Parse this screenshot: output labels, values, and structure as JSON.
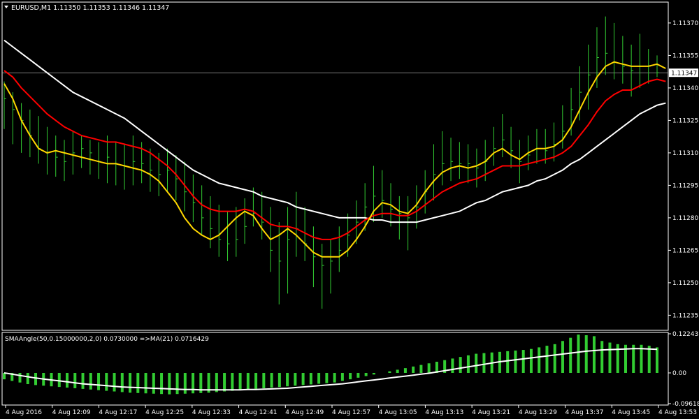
{
  "window": {
    "symbol_header": "EURUSD,M1  1.11350 1.11353 1.11346 1.11347",
    "current_price_label": "1.11347"
  },
  "colors": {
    "background": "#000000",
    "axis": "#ffffff",
    "bars": "#32cd32",
    "ma_fast": "#ffd700",
    "ma_mid": "#ff0000",
    "ma_slow": "#ffffff",
    "price_line": "#c0c0c0"
  },
  "icons": {
    "header_arrow": "triangle-down-icon"
  },
  "chart_data": [
    {
      "type": "line",
      "title": "EURUSD,M1",
      "ylim": [
        1.11229,
        1.11379
      ],
      "y_ticks": [
        "1.11370",
        "1.11355",
        "1.11340",
        "1.11325",
        "1.11310",
        "1.11295",
        "1.11280",
        "1.11265",
        "1.11250",
        "1.11235"
      ],
      "y_tick_values": [
        1.1137,
        1.11355,
        1.1134,
        1.11325,
        1.1131,
        1.11295,
        1.1128,
        1.11265,
        1.1125,
        1.11235
      ],
      "current_price": 1.11347,
      "bars": [
        {
          "h": 1.11343,
          "l": 1.11321,
          "c": 1.11335
        },
        {
          "h": 1.11338,
          "l": 1.11314,
          "c": 1.1133
        },
        {
          "h": 1.11333,
          "l": 1.1131,
          "c": 1.11325
        },
        {
          "h": 1.1133,
          "l": 1.11308,
          "c": 1.11318
        },
        {
          "h": 1.11327,
          "l": 1.11305,
          "c": 1.11312
        },
        {
          "h": 1.11322,
          "l": 1.113,
          "c": 1.1131
        },
        {
          "h": 1.11318,
          "l": 1.11299,
          "c": 1.11308
        },
        {
          "h": 1.11316,
          "l": 1.11297,
          "c": 1.11306
        },
        {
          "h": 1.1132,
          "l": 1.113,
          "c": 1.1131
        },
        {
          "h": 1.11318,
          "l": 1.11303,
          "c": 1.11312
        },
        {
          "h": 1.11316,
          "l": 1.113,
          "c": 1.1131
        },
        {
          "h": 1.11315,
          "l": 1.11298,
          "c": 1.11306
        },
        {
          "h": 1.11318,
          "l": 1.11296,
          "c": 1.11308
        },
        {
          "h": 1.11315,
          "l": 1.11295,
          "c": 1.11305
        },
        {
          "h": 1.11314,
          "l": 1.11293,
          "c": 1.11304
        },
        {
          "h": 1.11318,
          "l": 1.11295,
          "c": 1.11306
        },
        {
          "h": 1.11315,
          "l": 1.11296,
          "c": 1.11305
        },
        {
          "h": 1.11312,
          "l": 1.11292,
          "c": 1.11302
        },
        {
          "h": 1.1131,
          "l": 1.1129,
          "c": 1.113
        },
        {
          "h": 1.11312,
          "l": 1.11292,
          "c": 1.11302
        },
        {
          "h": 1.11309,
          "l": 1.11288,
          "c": 1.11298
        },
        {
          "h": 1.11306,
          "l": 1.11283,
          "c": 1.11292
        },
        {
          "h": 1.113,
          "l": 1.11278,
          "c": 1.11287
        },
        {
          "h": 1.11295,
          "l": 1.11272,
          "c": 1.1128
        },
        {
          "h": 1.1129,
          "l": 1.11266,
          "c": 1.11275
        },
        {
          "h": 1.11286,
          "l": 1.11262,
          "c": 1.1127
        },
        {
          "h": 1.11283,
          "l": 1.1126,
          "c": 1.11268
        },
        {
          "h": 1.11285,
          "l": 1.11262,
          "c": 1.1127
        },
        {
          "h": 1.11289,
          "l": 1.11268,
          "c": 1.11276
        },
        {
          "h": 1.11294,
          "l": 1.11276,
          "c": 1.11282
        },
        {
          "h": 1.11292,
          "l": 1.1127,
          "c": 1.11278
        },
        {
          "h": 1.11285,
          "l": 1.11255,
          "c": 1.11265
        },
        {
          "h": 1.11278,
          "l": 1.1124,
          "c": 1.1126
        },
        {
          "h": 1.11285,
          "l": 1.11245,
          "c": 1.1127
        },
        {
          "h": 1.11292,
          "l": 1.11262,
          "c": 1.11275
        },
        {
          "h": 1.11285,
          "l": 1.1126,
          "c": 1.11268
        },
        {
          "h": 1.11276,
          "l": 1.11248,
          "c": 1.11262
        },
        {
          "h": 1.11268,
          "l": 1.11238,
          "c": 1.11258
        },
        {
          "h": 1.1127,
          "l": 1.11245,
          "c": 1.1126
        },
        {
          "h": 1.11276,
          "l": 1.11255,
          "c": 1.11265
        },
        {
          "h": 1.11282,
          "l": 1.11262,
          "c": 1.11272
        },
        {
          "h": 1.11288,
          "l": 1.11268,
          "c": 1.11278
        },
        {
          "h": 1.11296,
          "l": 1.11274,
          "c": 1.11285
        },
        {
          "h": 1.11304,
          "l": 1.11278,
          "c": 1.1129
        },
        {
          "h": 1.11302,
          "l": 1.1128,
          "c": 1.11288
        },
        {
          "h": 1.11296,
          "l": 1.11276,
          "c": 1.11284
        },
        {
          "h": 1.1129,
          "l": 1.1127,
          "c": 1.11282
        },
        {
          "h": 1.1129,
          "l": 1.11265,
          "c": 1.1128
        },
        {
          "h": 1.11295,
          "l": 1.11275,
          "c": 1.11285
        },
        {
          "h": 1.11302,
          "l": 1.11282,
          "c": 1.11292
        },
        {
          "h": 1.11314,
          "l": 1.11288,
          "c": 1.113
        },
        {
          "h": 1.1132,
          "l": 1.11295,
          "c": 1.11305
        },
        {
          "h": 1.11317,
          "l": 1.11297,
          "c": 1.11306
        },
        {
          "h": 1.11315,
          "l": 1.11298,
          "c": 1.11305
        },
        {
          "h": 1.11314,
          "l": 1.11296,
          "c": 1.11305
        },
        {
          "h": 1.11312,
          "l": 1.11294,
          "c": 1.11303
        },
        {
          "h": 1.11316,
          "l": 1.11297,
          "c": 1.11306
        },
        {
          "h": 1.11322,
          "l": 1.11304,
          "c": 1.11312
        },
        {
          "h": 1.11328,
          "l": 1.11308,
          "c": 1.11316
        },
        {
          "h": 1.11322,
          "l": 1.11303,
          "c": 1.11311
        },
        {
          "h": 1.11316,
          "l": 1.11296,
          "c": 1.11306
        },
        {
          "h": 1.11318,
          "l": 1.11302,
          "c": 1.11309
        },
        {
          "h": 1.11321,
          "l": 1.11305,
          "c": 1.11312
        },
        {
          "h": 1.11321,
          "l": 1.11305,
          "c": 1.11311
        },
        {
          "h": 1.11324,
          "l": 1.11306,
          "c": 1.11314
        },
        {
          "h": 1.11332,
          "l": 1.11312,
          "c": 1.1132
        },
        {
          "h": 1.1134,
          "l": 1.11318,
          "c": 1.1133
        },
        {
          "h": 1.1135,
          "l": 1.11325,
          "c": 1.11338
        },
        {
          "h": 1.1136,
          "l": 1.1133,
          "c": 1.11346
        },
        {
          "h": 1.11368,
          "l": 1.1134,
          "c": 1.11354
        },
        {
          "h": 1.11373,
          "l": 1.11346,
          "c": 1.11356
        },
        {
          "h": 1.1137,
          "l": 1.11344,
          "c": 1.11352
        },
        {
          "h": 1.11364,
          "l": 1.11342,
          "c": 1.1135
        },
        {
          "h": 1.1136,
          "l": 1.11336,
          "c": 1.11348
        },
        {
          "h": 1.11365,
          "l": 1.1134,
          "c": 1.1135
        },
        {
          "h": 1.11358,
          "l": 1.11342,
          "c": 1.1135
        },
        {
          "h": 1.11355,
          "l": 1.11345,
          "c": 1.11347
        }
      ],
      "series": [
        {
          "role": "ma_fast",
          "values": [
            1.11342,
            1.11335,
            1.11325,
            1.11318,
            1.11312,
            1.1131,
            1.11311,
            1.1131,
            1.11309,
            1.11308,
            1.11307,
            1.11306,
            1.11305,
            1.11305,
            1.11304,
            1.11303,
            1.11302,
            1.113,
            1.11297,
            1.11292,
            1.11287,
            1.1128,
            1.11275,
            1.11272,
            1.1127,
            1.11272,
            1.11276,
            1.1128,
            1.11283,
            1.11281,
            1.11275,
            1.1127,
            1.11272,
            1.11275,
            1.11272,
            1.11268,
            1.11264,
            1.11262,
            1.11262,
            1.11262,
            1.11265,
            1.1127,
            1.11276,
            1.11283,
            1.11287,
            1.11286,
            1.11283,
            1.11282,
            1.11286,
            1.11292,
            1.11297,
            1.11301,
            1.11303,
            1.11304,
            1.11303,
            1.11304,
            1.11306,
            1.1131,
            1.11312,
            1.11309,
            1.11307,
            1.1131,
            1.11312,
            1.11312,
            1.11313,
            1.11316,
            1.11322,
            1.1133,
            1.11338,
            1.11345,
            1.1135,
            1.11352,
            1.11351,
            1.1135,
            1.1135,
            1.1135,
            1.11351,
            1.11349
          ]
        },
        {
          "role": "ma_mid",
          "values": [
            1.11348,
            1.11345,
            1.1134,
            1.11336,
            1.11332,
            1.11328,
            1.11325,
            1.11322,
            1.1132,
            1.11318,
            1.11317,
            1.11316,
            1.11315,
            1.11315,
            1.11314,
            1.11313,
            1.11312,
            1.1131,
            1.11307,
            1.11304,
            1.113,
            1.11295,
            1.1129,
            1.11286,
            1.11284,
            1.11283,
            1.11283,
            1.11283,
            1.11284,
            1.11283,
            1.1128,
            1.11277,
            1.11276,
            1.11276,
            1.11275,
            1.11273,
            1.11271,
            1.1127,
            1.1127,
            1.11271,
            1.11273,
            1.11276,
            1.11279,
            1.11281,
            1.11282,
            1.11282,
            1.11281,
            1.11281,
            1.11283,
            1.11286,
            1.11289,
            1.11292,
            1.11294,
            1.11296,
            1.11297,
            1.11298,
            1.113,
            1.11302,
            1.11304,
            1.11304,
            1.11304,
            1.11305,
            1.11306,
            1.11307,
            1.11308,
            1.1131,
            1.11313,
            1.11318,
            1.11323,
            1.11329,
            1.11334,
            1.11337,
            1.11339,
            1.11339,
            1.11341,
            1.11343,
            1.11344,
            1.11343
          ]
        },
        {
          "role": "ma_slow",
          "values": [
            1.11362,
            1.11359,
            1.11356,
            1.11353,
            1.1135,
            1.11347,
            1.11344,
            1.11341,
            1.11338,
            1.11336,
            1.11334,
            1.11332,
            1.1133,
            1.11328,
            1.11326,
            1.11323,
            1.1132,
            1.11317,
            1.11314,
            1.11311,
            1.11308,
            1.11305,
            1.11302,
            1.113,
            1.11298,
            1.11296,
            1.11295,
            1.11294,
            1.11293,
            1.11292,
            1.1129,
            1.11289,
            1.11288,
            1.11287,
            1.11285,
            1.11284,
            1.11283,
            1.11282,
            1.11281,
            1.1128,
            1.1128,
            1.1128,
            1.1128,
            1.11279,
            1.11279,
            1.11278,
            1.11278,
            1.11278,
            1.11278,
            1.11279,
            1.1128,
            1.11281,
            1.11282,
            1.11283,
            1.11285,
            1.11287,
            1.11288,
            1.1129,
            1.11292,
            1.11293,
            1.11294,
            1.11295,
            1.11297,
            1.11298,
            1.113,
            1.11302,
            1.11305,
            1.11307,
            1.1131,
            1.11313,
            1.11316,
            1.11319,
            1.11322,
            1.11325,
            1.11328,
            1.1133,
            1.11332,
            1.11333
          ]
        }
      ]
    },
    {
      "type": "bar",
      "title": "SMAAngle(50,0.15000000,2,0) 0.0730000  =>MA(21) 0.0716429",
      "ylim": [
        -0.096187,
        0.122437
      ],
      "y_ticks": [
        "0.122437",
        "0.00",
        "-0.096187"
      ],
      "y_tick_values": [
        0.122437,
        0.0,
        -0.096187
      ],
      "x_ticks": [
        "4 Aug 2016",
        "4 Aug 12:09",
        "4 Aug 12:17",
        "4 Aug 12:25",
        "4 Aug 12:33",
        "4 Aug 12:41",
        "4 Aug 12:49",
        "4 Aug 12:57",
        "4 Aug 13:05",
        "4 Aug 13:13",
        "4 Aug 13:21",
        "4 Aug 13:29",
        "4 Aug 13:37",
        "4 Aug 13:45",
        "4 Aug 13:53"
      ],
      "series": [
        {
          "role": "histogram",
          "values": [
            -0.02,
            -0.025,
            -0.03,
            -0.035,
            -0.038,
            -0.04,
            -0.042,
            -0.044,
            -0.046,
            -0.048,
            -0.05,
            -0.052,
            -0.054,
            -0.056,
            -0.058,
            -0.06,
            -0.062,
            -0.063,
            -0.064,
            -0.065,
            -0.066,
            -0.067,
            -0.066,
            -0.065,
            -0.064,
            -0.063,
            -0.062,
            -0.06,
            -0.058,
            -0.056,
            -0.054,
            -0.052,
            -0.05,
            -0.048,
            -0.046,
            -0.044,
            -0.042,
            -0.04,
            -0.038,
            -0.036,
            -0.034,
            -0.032,
            -0.03,
            -0.025,
            -0.02,
            -0.015,
            -0.01,
            -0.005,
            0.0,
            0.005,
            0.01,
            0.015,
            0.02,
            0.025,
            0.03,
            0.035,
            0.04,
            0.045,
            0.05,
            0.055,
            0.06,
            0.062,
            0.064,
            0.066,
            0.068,
            0.07,
            0.072,
            0.075,
            0.08,
            0.085,
            0.09,
            0.1,
            0.11,
            0.12,
            0.118,
            0.115,
            0.1,
            0.095,
            0.09,
            0.088,
            0.088,
            0.088,
            0.085,
            0.08
          ]
        },
        {
          "role": "ma",
          "values": [
            0.0,
            -0.004,
            -0.008,
            -0.012,
            -0.016,
            -0.019,
            -0.022,
            -0.025,
            -0.028,
            -0.031,
            -0.034,
            -0.036,
            -0.038,
            -0.04,
            -0.042,
            -0.044,
            -0.045,
            -0.046,
            -0.047,
            -0.048,
            -0.049,
            -0.05,
            -0.051,
            -0.052,
            -0.052,
            -0.053,
            -0.053,
            -0.053,
            -0.053,
            -0.053,
            -0.053,
            -0.052,
            -0.052,
            -0.051,
            -0.05,
            -0.049,
            -0.048,
            -0.046,
            -0.044,
            -0.042,
            -0.04,
            -0.038,
            -0.036,
            -0.034,
            -0.031,
            -0.028,
            -0.025,
            -0.022,
            -0.019,
            -0.016,
            -0.013,
            -0.01,
            -0.007,
            -0.004,
            -0.001,
            0.003,
            0.007,
            0.011,
            0.015,
            0.019,
            0.023,
            0.027,
            0.031,
            0.035,
            0.038,
            0.041,
            0.044,
            0.047,
            0.05,
            0.053,
            0.056,
            0.059,
            0.062,
            0.065,
            0.068,
            0.07,
            0.072,
            0.073,
            0.074,
            0.075,
            0.076,
            0.076,
            0.075,
            0.074
          ]
        }
      ]
    }
  ]
}
